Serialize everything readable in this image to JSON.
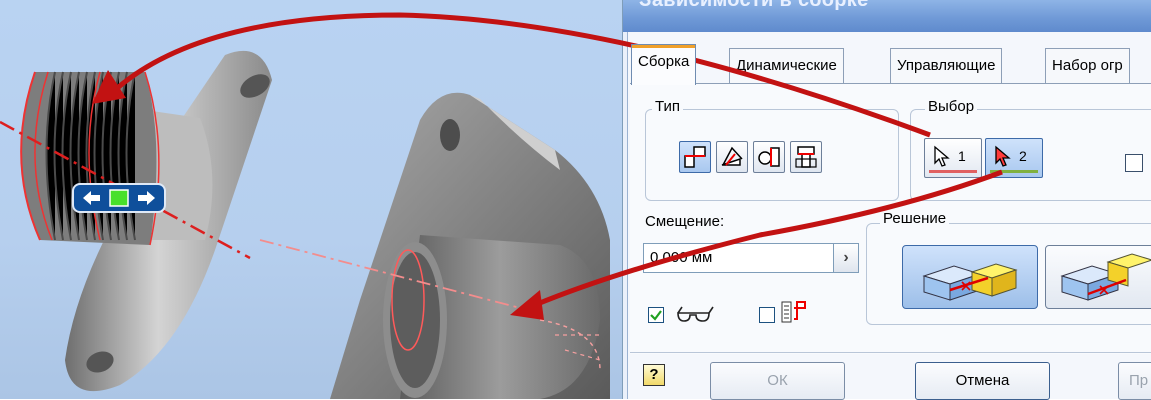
{
  "dialog": {
    "title": "Зависимости в сборке",
    "tabs": [
      {
        "label": "Сборка",
        "active": true
      },
      {
        "label": "Динамические",
        "active": false
      },
      {
        "label": "Управляющие",
        "active": false
      },
      {
        "label": "Набор огр",
        "active": false
      }
    ],
    "type_group": {
      "label": "Тип",
      "buttons": [
        {
          "name": "mate",
          "selected": true
        },
        {
          "name": "angle",
          "selected": false
        },
        {
          "name": "tangent",
          "selected": false
        },
        {
          "name": "insert",
          "selected": false
        }
      ]
    },
    "selection_group": {
      "label": "Выбор",
      "first_num": "1",
      "second_num": "2",
      "second_selected": true
    },
    "offset": {
      "label": "Смещение:",
      "value": "0,000 мм"
    },
    "show_preview_checked": true,
    "predict_offset_checked": false,
    "solution_group": {
      "label": "Решение",
      "selected_index": 0
    },
    "footer": {
      "help": "?",
      "ok": "ОК",
      "cancel": "Отмена",
      "apply": "Пр"
    }
  },
  "colors": {
    "annotation_arrow": "#c21212",
    "tab_highlight": "#f0a02a",
    "selection_1_underline": "#e06060",
    "selection_2_underline": "#80b040"
  }
}
